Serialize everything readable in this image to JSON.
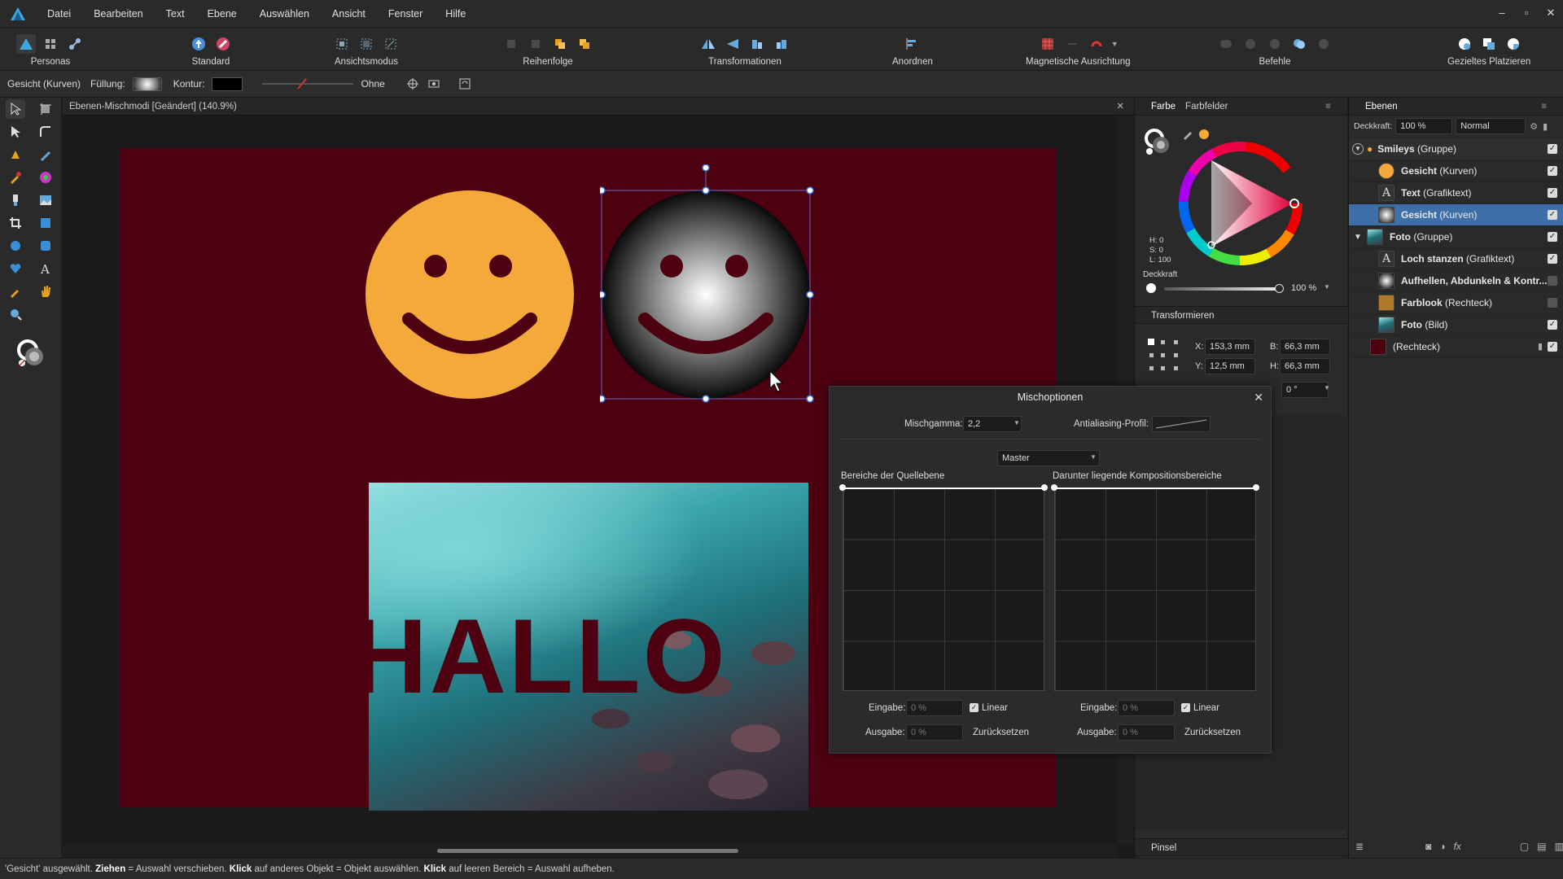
{
  "menubar": {
    "items": [
      "Datei",
      "Bearbeiten",
      "Text",
      "Ebene",
      "Auswählen",
      "Ansicht",
      "Fenster",
      "Hilfe"
    ],
    "win_controls": [
      "–",
      "▫",
      "✕"
    ]
  },
  "toolbar": {
    "personas": "Personas",
    "standard": "Standard",
    "ansichtsmodus": "Ansichtsmodus",
    "reihenfolge": "Reihenfolge",
    "transformationen": "Transformationen",
    "anordnen": "Anordnen",
    "magnetische": "Magnetische Ausrichtung",
    "befehle": "Befehle",
    "gezieltes": "Gezieltes Platzieren"
  },
  "contextbar": {
    "object": "Gesicht (Kurven)",
    "fill_label": "Füllung:",
    "stroke_label": "Kontur:",
    "stroke_style": "Ohne"
  },
  "document": {
    "tab_title": "Ebenen-Mischmodi [Geändert] (140.9%)",
    "canvas_text": "HALLO"
  },
  "colorpanel": {
    "tabs": [
      "Farbe",
      "Farbfelder"
    ],
    "h": "H: 0",
    "s": "S: 0",
    "l": "L: 100",
    "opacity_label": "Deckkraft",
    "opacity_value": "100 %",
    "transform_title": "Transformieren",
    "x_label": "X:",
    "x_value": "153,3 mm",
    "y_label": "Y:",
    "y_value": "12,5 mm",
    "b_label": "B:",
    "b_value": "66,3 mm",
    "h_label": "H:",
    "h_value": "66,3 mm",
    "rot_value": "0 °",
    "brush_title": "Pinsel"
  },
  "layers": {
    "title": "Ebenen",
    "opacity_label": "Deckkraft:",
    "opacity_value": "100 %",
    "blend_mode": "Normal",
    "rows": [
      {
        "name": "Smileys",
        "type": "(Gruppe)"
      },
      {
        "name": "Gesicht",
        "type": "(Kurven)"
      },
      {
        "name": "Text",
        "type": "(Grafiktext)"
      },
      {
        "name": "Gesicht",
        "type": "(Kurven)"
      },
      {
        "name": "Foto",
        "type": "(Gruppe)"
      },
      {
        "name": "Loch stanzen",
        "type": "(Grafiktext)"
      },
      {
        "name": "Aufhellen, Abdunkeln & Kontr...",
        "type": ""
      },
      {
        "name": "Farblook",
        "type": "(Rechteck)"
      },
      {
        "name": "Foto",
        "type": "(Bild)"
      },
      {
        "name": "",
        "type": "(Rechteck)"
      }
    ]
  },
  "dialog": {
    "title": "Mischoptionen",
    "gamma_label": "Mischgamma:",
    "gamma_value": "2,2",
    "aa_label": "Antialiasing-Profil:",
    "channel": "Master",
    "source_label": "Bereiche der Quellebene",
    "under_label": "Darunter liegende Kompositionsbereiche",
    "input_label": "Eingabe:",
    "output_label": "Ausgabe:",
    "input_value": "0 %",
    "output_value": "0 %",
    "linear_label": "Linear",
    "reset_label": "Zurücksetzen"
  },
  "status": {
    "p1": "'Gesicht' ausgewählt. ",
    "b1": "Ziehen",
    "p2": " = Auswahl verschieben. ",
    "b2": "Klick",
    "p3": " auf anderes Objekt = Objekt auswählen. ",
    "b3": "Klick",
    "p4": " auf leeren Bereich = Auswahl aufheben."
  },
  "colors": {
    "artboard": "#4d0010",
    "smiley": "#f4a93a",
    "selection": "#3f6fa8"
  }
}
